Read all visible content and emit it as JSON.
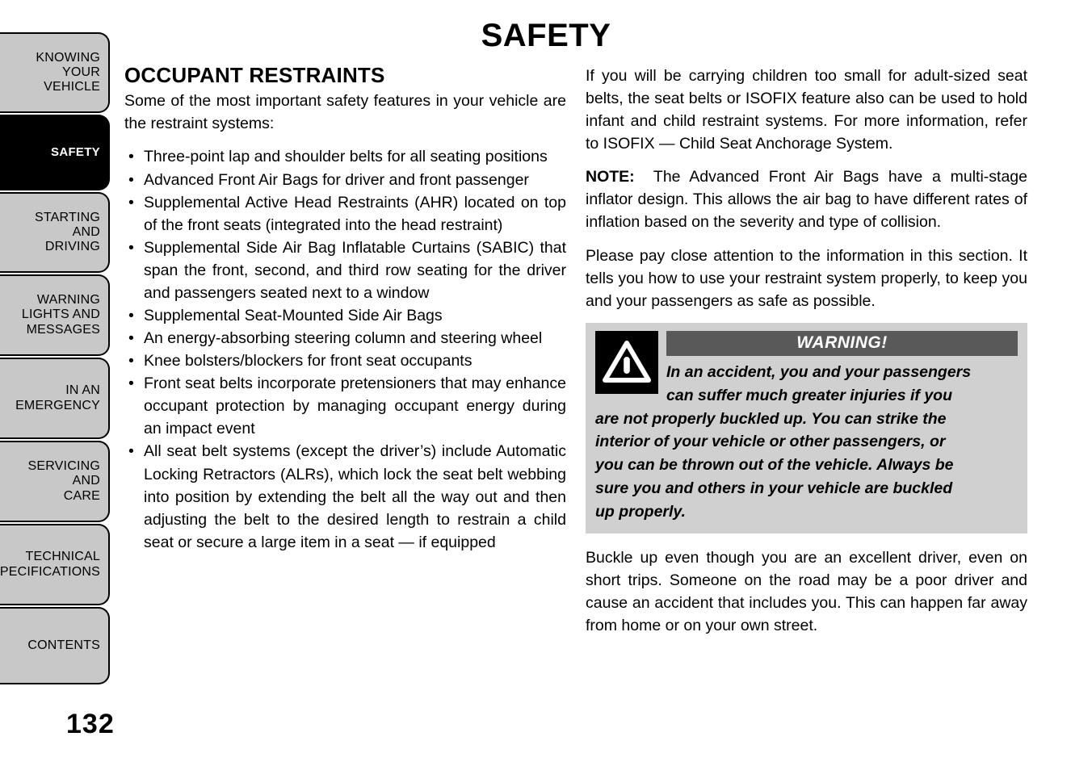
{
  "page": {
    "title": "SAFETY",
    "number": "132"
  },
  "sidebar": {
    "items": [
      {
        "label": "KNOWING\nYOUR\nVEHICLE",
        "active": false
      },
      {
        "label": "SAFETY",
        "active": true
      },
      {
        "label": "STARTING\nAND\nDRIVING",
        "active": false
      },
      {
        "label": "WARNING\nLIGHTS AND\nMESSAGES",
        "active": false
      },
      {
        "label": "IN AN\nEMERGENCY",
        "active": false
      },
      {
        "label": "SERVICING\nAND\nCARE",
        "active": false
      },
      {
        "label": "TECHNICAL\nSPECIFICATIONS",
        "active": false
      },
      {
        "label": "CONTENTS",
        "active": false
      }
    ]
  },
  "left_column": {
    "heading": "OCCUPANT RESTRAINTS",
    "intro": "Some of the most important safety features in your vehicle are the restraint systems:",
    "bullets": [
      "Three-point lap and shoulder belts for all seating positions",
      "Advanced Front Air Bags for driver and front passen­ger",
      "Supplemental Active Head Restraints (AHR) located on top of the front seats (integrated into the head restraint)",
      "Supplemental Side Air Bag Inflatable Curtains (SABIC) that span the front, second, and third row seating for the driver and passengers seated next to a window",
      "Supplemental Seat-Mounted Side Air Bags",
      "An energy-absorbing steering column and steering wheel",
      "Knee bolsters/blockers for front seat occupants",
      "Front seat belts incorporate pretensioners that may enhance occupant protection by managing occupant energy during an impact event",
      "All seat belt systems (except the driver’s) include Automatic Locking Retractors (ALRs), which lock the seat belt webbing into position by extending the belt all the way out and then adjusting the belt to the desired length to restrain a child seat or secure a large item in a seat — if equipped"
    ]
  },
  "right_column": {
    "para_isofix": "If you will be carrying children too small for adult-sized seat belts, the seat belts or ISOFIX feature also can be used to hold infant and child restraint systems. For more information, refer to ISOFIX — Child Seat An­chorage System.",
    "note_label": "NOTE:",
    "note_text": "The Advanced Front Air Bags have a multi-stage inflator design. This allows the air bag to have different rates of inflation based on the severity and type of collision.",
    "para_attention": "Please pay close attention to the information in this section. It tells you how to use your restraint system properly, to keep you and your passengers as safe as possible.",
    "warning": {
      "icon": "warning-triangle-icon",
      "title": "WARNING!",
      "lines_indented": [
        "In an accident, you and your passengers",
        "can suffer much greater injuries if you"
      ],
      "lines_full": [
        "are not properly buckled up. You can strike the",
        "interior of your vehicle or other passengers, or",
        "you can be thrown out of the vehicle. Always be",
        "sure you and others in your vehicle are buckled",
        "up properly."
      ]
    },
    "para_buckle": "Buckle up even though you are an excellent driver, even on short trips. Someone on the road may be a poor driver and cause an accident that includes you. This can happen far away from home or on your own street."
  },
  "colors": {
    "tab_fill": "#c8c8c8",
    "tab_active_fill": "#000000",
    "warning_box_bg": "#d0d0d0",
    "warning_title_bar": "#595959",
    "text": "#000000"
  }
}
